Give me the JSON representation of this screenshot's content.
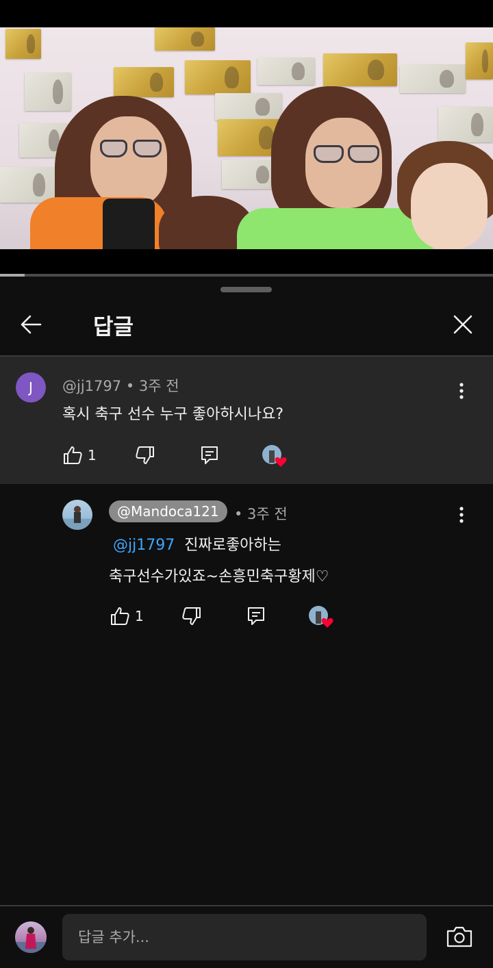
{
  "video": {
    "progress_fraction": 0.05
  },
  "sheet": {
    "title": "답글"
  },
  "parent_comment": {
    "avatar_letter": "J",
    "author": "@jj1797",
    "time": "• 3주 전",
    "text": "혹시 축구 선수 누구 좋아하시나요?",
    "like_count": "1"
  },
  "reply": {
    "author": "@Mandoca121",
    "time": "• 3주 전",
    "mention": "@jj1797",
    "text_line1": "진짜로좋아하는",
    "text_line2": "축구선수가있죠~손흥민축구황제♡",
    "like_count": "1"
  },
  "composer": {
    "placeholder": "답글 추가..."
  },
  "colors": {
    "background": "#0f0f0f",
    "parent_highlight": "#272727",
    "mention": "#3ea6ff",
    "avatar_purple": "#7e57c2",
    "heart": "#ff0033"
  }
}
